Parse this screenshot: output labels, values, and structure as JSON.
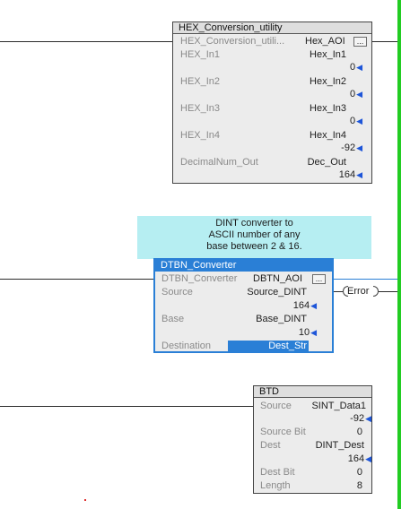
{
  "rail_color": "#22cc22",
  "accent": "#2a7fd6",
  "hex_block": {
    "title": "HEX_Conversion_utility",
    "rows": [
      {
        "label": "HEX_Conversion_utili...",
        "tag": "Hex_AOI",
        "button": "..."
      },
      {
        "label": "HEX_In1",
        "tag": "Hex_In1",
        "value": "0"
      },
      {
        "label": "HEX_In2",
        "tag": "Hex_In2",
        "value": "0"
      },
      {
        "label": "HEX_In3",
        "tag": "Hex_In3",
        "value": "0"
      },
      {
        "label": "HEX_In4",
        "tag": "Hex_In4",
        "value": "-92"
      },
      {
        "label": "DecimalNum_Out",
        "tag": "Dec_Out",
        "value": "164"
      }
    ]
  },
  "comment": {
    "line1": "DINT converter to",
    "line2": "ASCII number of any",
    "line3": "base between 2 & 16."
  },
  "dtbn_block": {
    "title": "DTBN_Converter",
    "rows": [
      {
        "label": "DTBN_Converter",
        "tag": "DBTN_AOI",
        "button": "..."
      },
      {
        "label": "Source",
        "tag": "Source_DINT",
        "value": "164"
      },
      {
        "label": "Base",
        "tag": "Base_DINT",
        "value": "10"
      },
      {
        "label": "Destination",
        "tag": "Dest_Str"
      }
    ],
    "output_coil": "Error"
  },
  "btd_block": {
    "title": "BTD",
    "rows": [
      {
        "label": "Source",
        "tag": "SINT_Data1",
        "value": "-92"
      },
      {
        "label": "Source Bit",
        "value": "0"
      },
      {
        "label": "Dest",
        "tag": "DINT_Dest",
        "value": "164"
      },
      {
        "label": "Dest Bit",
        "value": "0"
      },
      {
        "label": "Length",
        "value": "8"
      }
    ]
  },
  "icons": {
    "value_arrow": "left-arrow-icon"
  }
}
